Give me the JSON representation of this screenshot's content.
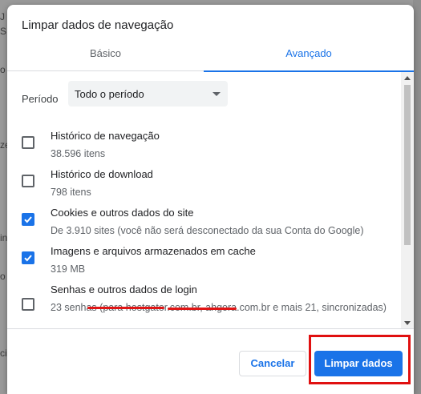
{
  "backdrop": {
    "fragments": [
      "J",
      "S",
      "o",
      "ze",
      "in",
      "o",
      "ci"
    ]
  },
  "dialog": {
    "title": "Limpar dados de navegação"
  },
  "tabs": [
    {
      "label": "Básico",
      "active": false
    },
    {
      "label": "Avançado",
      "active": true
    }
  ],
  "period": {
    "label": "Período",
    "selected": "Todo o período"
  },
  "items": [
    {
      "title": "Histórico de navegação",
      "subtitle": "38.596 itens",
      "checked": false
    },
    {
      "title": "Histórico de download",
      "subtitle": "798 itens",
      "checked": false
    },
    {
      "title": "Cookies e outros dados do site",
      "subtitle": "De 3.910 sites (você não será desconectado da sua Conta do Google)",
      "checked": true
    },
    {
      "title": "Imagens e arquivos armazenados em cache",
      "subtitle": "319 MB",
      "checked": true
    },
    {
      "title": "Senhas e outros dados de login",
      "subtitle": "23 senhas (para hostgator.com.br, ahgora.com.br e mais 21, sincronizadas)",
      "checked": false
    }
  ],
  "buttons": {
    "cancel": "Cancelar",
    "clear": "Limpar dados"
  },
  "colors": {
    "accent": "#1a73e8",
    "highlight": "#e01010"
  },
  "icons": {
    "dropdown": "caret-down-icon",
    "check": "check-icon"
  }
}
